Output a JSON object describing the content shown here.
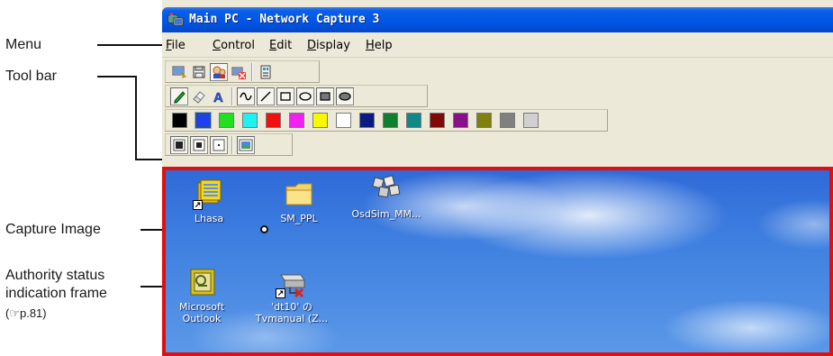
{
  "annotations": {
    "menu": "Menu",
    "toolbar": "Tool bar",
    "capture_image": "Capture Image",
    "authority_lines": [
      "Authority status",
      "indication frame",
      "(☞p.81)"
    ]
  },
  "window": {
    "title": "Main PC - Network Capture 3",
    "title_icon": "network-capture-icon"
  },
  "menu": [
    {
      "label": "File",
      "mnemonic": "F",
      "rest": "ile"
    },
    {
      "label": "Control",
      "mnemonic": "C",
      "rest": "ontrol"
    },
    {
      "label": "Edit",
      "mnemonic": "E",
      "rest": "dit"
    },
    {
      "label": "Display",
      "mnemonic": "D",
      "rest": "isplay"
    },
    {
      "label": "Help",
      "mnemonic": "H",
      "rest": "elp"
    }
  ],
  "toolbar": {
    "row1": [
      "capture-icon",
      "save-icon",
      "authority-icon",
      "disconnect-icon",
      "settings-icon"
    ],
    "row2": [
      "pen-icon",
      "eraser-icon",
      "text-icon",
      "freeline-icon",
      "line-icon",
      "rectangle-icon",
      "ellipse-icon",
      "filled-rectangle-icon",
      "filled-ellipse-icon"
    ],
    "palette": [
      "#000000",
      "#1f3ff0",
      "#20e020",
      "#20f0f0",
      "#f01010",
      "#f020f0",
      "#f8f800",
      "#ffffff",
      "#0a1a80",
      "#108030",
      "#108888",
      "#800808",
      "#881088",
      "#808010",
      "#808080",
      "#d0d0d0"
    ],
    "selected_color": "#1f3ff0",
    "row4": [
      "line-width-large-icon",
      "line-width-medium-icon",
      "line-width-small-icon",
      "display-mode-icon"
    ]
  },
  "desktop_icons": [
    {
      "label": "Lhasa",
      "icon": "lhasa-archive-icon"
    },
    {
      "label": "SM_PPL",
      "icon": "folder-icon"
    },
    {
      "label": "OsdSim_MM...",
      "icon": "osdsim-icon"
    },
    {
      "label": "Microsoft\nOutlook",
      "icon": "outlook-icon"
    },
    {
      "label": "'dt10' の\nTvmanual (Z...",
      "icon": "network-drive-icon"
    }
  ]
}
